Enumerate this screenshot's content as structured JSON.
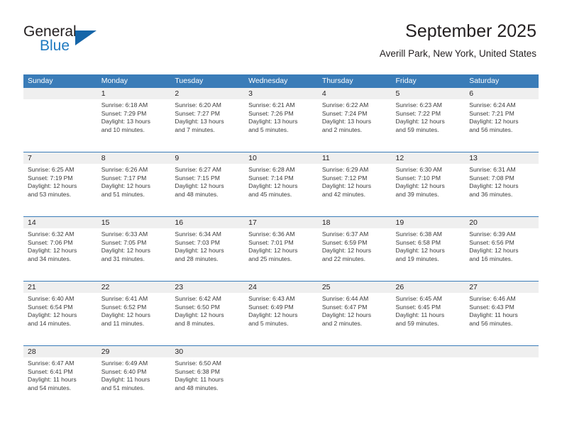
{
  "logo": {
    "word_top": "General",
    "word_bottom": "Blue",
    "triangle_color": "#1565a8",
    "blue_text_color": "#1f7ac1"
  },
  "header": {
    "title": "September 2025",
    "subtitle": "Averill Park, New York, United States"
  },
  "theme": {
    "header_row_bg": "#3a7cb8",
    "date_band_bg": "#efefef",
    "rule_color": "#3a7cb8",
    "text_color": "#231f20"
  },
  "calendar": {
    "day_names": [
      "Sunday",
      "Monday",
      "Tuesday",
      "Wednesday",
      "Thursday",
      "Friday",
      "Saturday"
    ],
    "weeks": [
      [
        {
          "day": "",
          "lines": []
        },
        {
          "day": "1",
          "lines": [
            "Sunrise: 6:18 AM",
            "Sunset: 7:29 PM",
            "Daylight: 13 hours",
            "and 10 minutes."
          ]
        },
        {
          "day": "2",
          "lines": [
            "Sunrise: 6:20 AM",
            "Sunset: 7:27 PM",
            "Daylight: 13 hours",
            "and 7 minutes."
          ]
        },
        {
          "day": "3",
          "lines": [
            "Sunrise: 6:21 AM",
            "Sunset: 7:26 PM",
            "Daylight: 13 hours",
            "and 5 minutes."
          ]
        },
        {
          "day": "4",
          "lines": [
            "Sunrise: 6:22 AM",
            "Sunset: 7:24 PM",
            "Daylight: 13 hours",
            "and 2 minutes."
          ]
        },
        {
          "day": "5",
          "lines": [
            "Sunrise: 6:23 AM",
            "Sunset: 7:22 PM",
            "Daylight: 12 hours",
            "and 59 minutes."
          ]
        },
        {
          "day": "6",
          "lines": [
            "Sunrise: 6:24 AM",
            "Sunset: 7:21 PM",
            "Daylight: 12 hours",
            "and 56 minutes."
          ]
        }
      ],
      [
        {
          "day": "7",
          "lines": [
            "Sunrise: 6:25 AM",
            "Sunset: 7:19 PM",
            "Daylight: 12 hours",
            "and 53 minutes."
          ]
        },
        {
          "day": "8",
          "lines": [
            "Sunrise: 6:26 AM",
            "Sunset: 7:17 PM",
            "Daylight: 12 hours",
            "and 51 minutes."
          ]
        },
        {
          "day": "9",
          "lines": [
            "Sunrise: 6:27 AM",
            "Sunset: 7:15 PM",
            "Daylight: 12 hours",
            "and 48 minutes."
          ]
        },
        {
          "day": "10",
          "lines": [
            "Sunrise: 6:28 AM",
            "Sunset: 7:14 PM",
            "Daylight: 12 hours",
            "and 45 minutes."
          ]
        },
        {
          "day": "11",
          "lines": [
            "Sunrise: 6:29 AM",
            "Sunset: 7:12 PM",
            "Daylight: 12 hours",
            "and 42 minutes."
          ]
        },
        {
          "day": "12",
          "lines": [
            "Sunrise: 6:30 AM",
            "Sunset: 7:10 PM",
            "Daylight: 12 hours",
            "and 39 minutes."
          ]
        },
        {
          "day": "13",
          "lines": [
            "Sunrise: 6:31 AM",
            "Sunset: 7:08 PM",
            "Daylight: 12 hours",
            "and 36 minutes."
          ]
        }
      ],
      [
        {
          "day": "14",
          "lines": [
            "Sunrise: 6:32 AM",
            "Sunset: 7:06 PM",
            "Daylight: 12 hours",
            "and 34 minutes."
          ]
        },
        {
          "day": "15",
          "lines": [
            "Sunrise: 6:33 AM",
            "Sunset: 7:05 PM",
            "Daylight: 12 hours",
            "and 31 minutes."
          ]
        },
        {
          "day": "16",
          "lines": [
            "Sunrise: 6:34 AM",
            "Sunset: 7:03 PM",
            "Daylight: 12 hours",
            "and 28 minutes."
          ]
        },
        {
          "day": "17",
          "lines": [
            "Sunrise: 6:36 AM",
            "Sunset: 7:01 PM",
            "Daylight: 12 hours",
            "and 25 minutes."
          ]
        },
        {
          "day": "18",
          "lines": [
            "Sunrise: 6:37 AM",
            "Sunset: 6:59 PM",
            "Daylight: 12 hours",
            "and 22 minutes."
          ]
        },
        {
          "day": "19",
          "lines": [
            "Sunrise: 6:38 AM",
            "Sunset: 6:58 PM",
            "Daylight: 12 hours",
            "and 19 minutes."
          ]
        },
        {
          "day": "20",
          "lines": [
            "Sunrise: 6:39 AM",
            "Sunset: 6:56 PM",
            "Daylight: 12 hours",
            "and 16 minutes."
          ]
        }
      ],
      [
        {
          "day": "21",
          "lines": [
            "Sunrise: 6:40 AM",
            "Sunset: 6:54 PM",
            "Daylight: 12 hours",
            "and 14 minutes."
          ]
        },
        {
          "day": "22",
          "lines": [
            "Sunrise: 6:41 AM",
            "Sunset: 6:52 PM",
            "Daylight: 12 hours",
            "and 11 minutes."
          ]
        },
        {
          "day": "23",
          "lines": [
            "Sunrise: 6:42 AM",
            "Sunset: 6:50 PM",
            "Daylight: 12 hours",
            "and 8 minutes."
          ]
        },
        {
          "day": "24",
          "lines": [
            "Sunrise: 6:43 AM",
            "Sunset: 6:49 PM",
            "Daylight: 12 hours",
            "and 5 minutes."
          ]
        },
        {
          "day": "25",
          "lines": [
            "Sunrise: 6:44 AM",
            "Sunset: 6:47 PM",
            "Daylight: 12 hours",
            "and 2 minutes."
          ]
        },
        {
          "day": "26",
          "lines": [
            "Sunrise: 6:45 AM",
            "Sunset: 6:45 PM",
            "Daylight: 11 hours",
            "and 59 minutes."
          ]
        },
        {
          "day": "27",
          "lines": [
            "Sunrise: 6:46 AM",
            "Sunset: 6:43 PM",
            "Daylight: 11 hours",
            "and 56 minutes."
          ]
        }
      ],
      [
        {
          "day": "28",
          "lines": [
            "Sunrise: 6:47 AM",
            "Sunset: 6:41 PM",
            "Daylight: 11 hours",
            "and 54 minutes."
          ]
        },
        {
          "day": "29",
          "lines": [
            "Sunrise: 6:49 AM",
            "Sunset: 6:40 PM",
            "Daylight: 11 hours",
            "and 51 minutes."
          ]
        },
        {
          "day": "30",
          "lines": [
            "Sunrise: 6:50 AM",
            "Sunset: 6:38 PM",
            "Daylight: 11 hours",
            "and 48 minutes."
          ]
        },
        {
          "day": "",
          "lines": []
        },
        {
          "day": "",
          "lines": []
        },
        {
          "day": "",
          "lines": []
        },
        {
          "day": "",
          "lines": []
        }
      ]
    ]
  }
}
